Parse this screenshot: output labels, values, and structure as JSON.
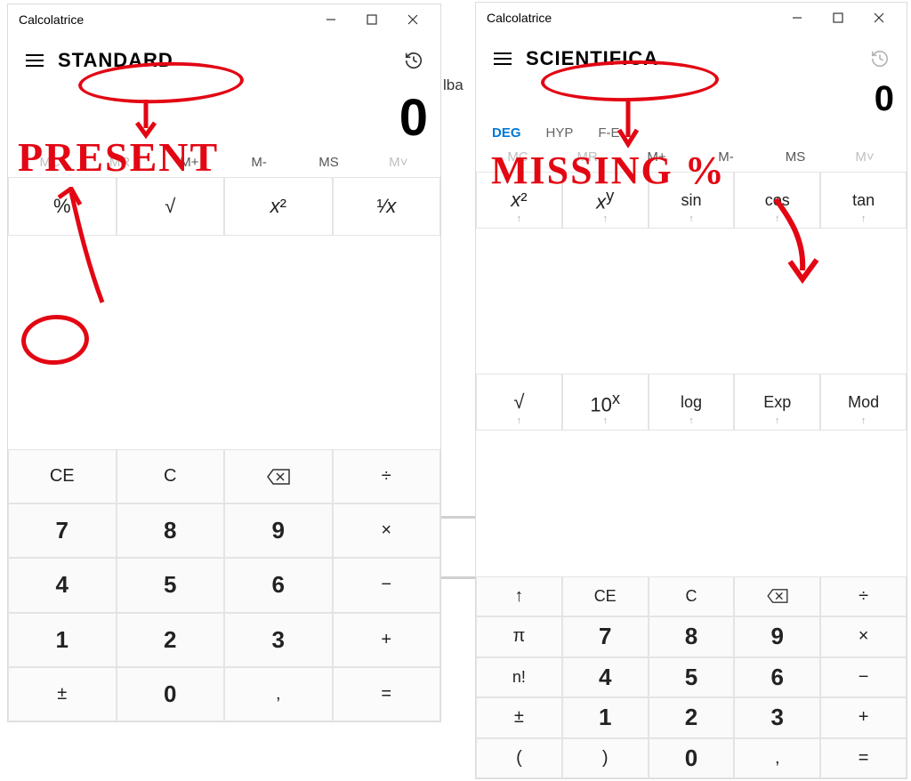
{
  "standard": {
    "window_title": "Calcolatrice",
    "mode_label": "STANDARD",
    "display": "0",
    "memory": {
      "mc": "MC",
      "mr": "MR",
      "mplus": "M+",
      "mminus": "M-",
      "ms": "MS",
      "mlist": "M˅"
    },
    "func_row": {
      "percent": "%",
      "sqrt": "√",
      "square": "x²",
      "recip": "¹⁄ₓ"
    },
    "ops": {
      "ce": "CE",
      "c": "C",
      "back": "⌫",
      "div": "÷",
      "mul": "×",
      "sub": "−",
      "add": "+",
      "eq": "=",
      "pm": "±",
      "dec": ","
    },
    "digits": {
      "d7": "7",
      "d8": "8",
      "d9": "9",
      "d4": "4",
      "d5": "5",
      "d6": "6",
      "d1": "1",
      "d2": "2",
      "d3": "3",
      "d0": "0"
    }
  },
  "scientific": {
    "window_title": "Calcolatrice",
    "mode_label": "SCIENTIFICA",
    "display": "0",
    "angle": {
      "deg": "DEG",
      "hyp": "HYP",
      "fe": "F-E"
    },
    "memory": {
      "mc": "MC",
      "mr": "MR",
      "mplus": "M+",
      "mminus": "M-",
      "ms": "MS",
      "mlist": "M˅"
    },
    "fn1": {
      "xsq": "x²",
      "xy": "xʸ",
      "sin": "sin",
      "cos": "cos",
      "tan": "tan"
    },
    "fn2": {
      "sqrt": "√",
      "tenx": "10ˣ",
      "log": "log",
      "exp": "Exp",
      "mod": "Mod"
    },
    "row3": {
      "up": "↑",
      "ce": "CE",
      "c": "C",
      "back": "⌫",
      "div": "÷"
    },
    "row4": {
      "pi": "π",
      "d7": "7",
      "d8": "8",
      "d9": "9",
      "mul": "×"
    },
    "row5": {
      "fact": "n!",
      "d4": "4",
      "d5": "5",
      "d6": "6",
      "sub": "−"
    },
    "row6": {
      "pm": "±",
      "d1": "1",
      "d2": "2",
      "d3": "3",
      "add": "+"
    },
    "row7": {
      "lp": "(",
      "rp": ")",
      "d0": "0",
      "dec": ",",
      "eq": "="
    }
  },
  "annotations": {
    "present": "PRESENT",
    "missing": "MISSING"
  },
  "colors": {
    "ink": "#e30613",
    "accent": "#0078d7"
  },
  "behind_text": "lba"
}
